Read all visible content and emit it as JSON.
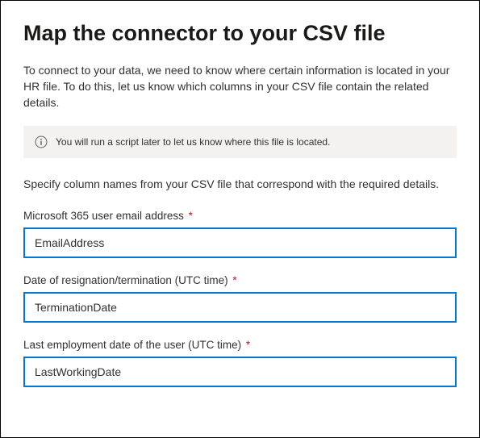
{
  "heading": "Map the connector to your CSV file",
  "intro": "To connect to your data, we need to know where certain information is located in your HR file. To do this, let us know which columns in your CSV file contain the related details.",
  "info_message": "You will run a script later to let us know where this file is located.",
  "instructions": "Specify column names from your CSV file that correspond with the required details.",
  "fields": {
    "email": {
      "label": "Microsoft 365 user email address",
      "value": "EmailAddress"
    },
    "termination": {
      "label": "Date of resignation/termination (UTC time)",
      "value": "TerminationDate"
    },
    "last_working": {
      "label": "Last employment date of the user (UTC time)",
      "value": "LastWorkingDate"
    }
  },
  "required_marker": "*"
}
